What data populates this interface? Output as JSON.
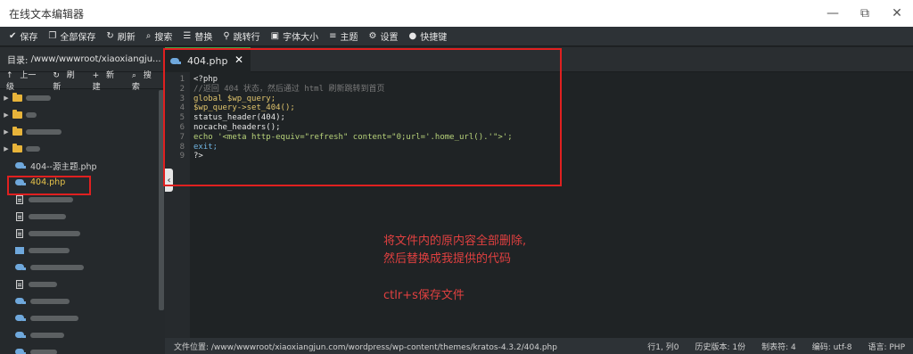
{
  "window": {
    "title": "在线文本编辑器",
    "minimize_icon": "minimize-icon",
    "restore_icon": "restore-icon",
    "close_icon": "close-icon"
  },
  "toolbar": {
    "save": "保存",
    "save_all": "全部保存",
    "refresh": "刷新",
    "search": "搜索",
    "replace": "替换",
    "goto_line": "跳转行",
    "font_size": "字体大小",
    "theme": "主题",
    "settings": "设置",
    "shortcuts": "快捷键"
  },
  "sidebar": {
    "dir_label": "目录:",
    "dir_path": "/www/wwwroot/xiaoxiangju...",
    "up": "上一级",
    "refresh": "刷新",
    "new": "新建",
    "search": "搜索",
    "files": [
      {
        "name": "404--源主题.php"
      },
      {
        "name": "404.php"
      }
    ]
  },
  "editor": {
    "tab_label": "404.php",
    "line_numbers": [
      "1",
      "2",
      "3",
      "4",
      "5",
      "6",
      "7",
      "8",
      "9"
    ],
    "lines": [
      "<?php",
      "//返回 404 状态，然后通过 html 刷新跳转到首页",
      "global $wp_query;",
      "$wp_query->set_404();",
      "status_header(404);",
      "nocache_headers();",
      "echo '<meta http-equiv=\"refresh\" content=\"0;url='.home_url().'\">';",
      "exit;",
      "?>"
    ]
  },
  "annotations": {
    "line1": "将文件内的原内容全部删除,",
    "line2": "然后替换成我提供的代码",
    "line3": "ctlr+s保存文件"
  },
  "status": {
    "path": "文件位置: /www/wwwroot/xiaoxiangjun.com/wordpress/wp-content/themes/kratos-4.3.2/404.php",
    "cursor": "行1, 列0",
    "history": "历史版本: 1份",
    "tab_size": "制表符: 4",
    "encoding": "编码: utf-8",
    "language": "语言: PHP"
  },
  "colors": {
    "highlight_border": "#e02020",
    "annotation_text": "#e04040",
    "tab_accent": "#3fa84a"
  }
}
